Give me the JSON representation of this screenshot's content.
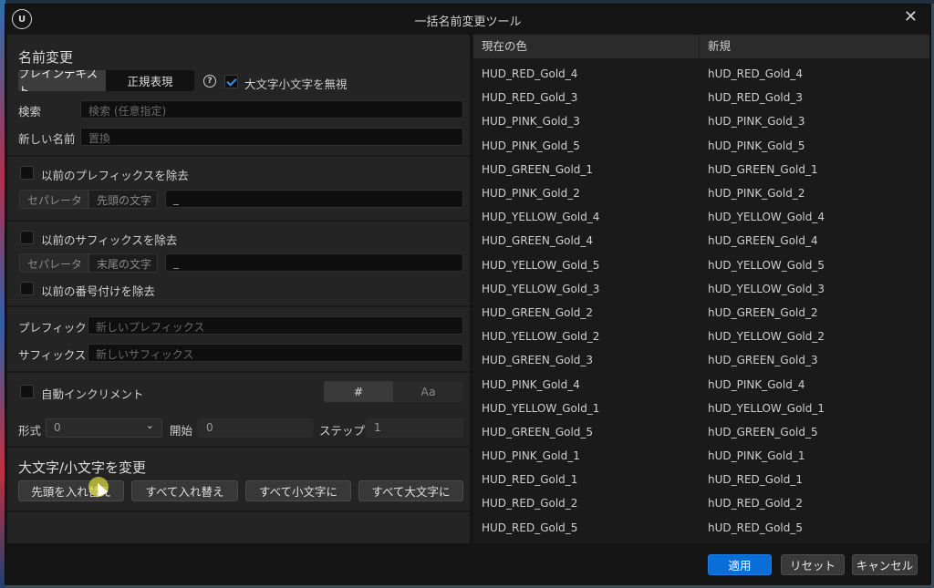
{
  "window": {
    "title": "一括名前変更ツール"
  },
  "rename": {
    "section_title": "名前変更",
    "mode_plain": "プレインテキスト",
    "mode_regex": "正規表現",
    "ignore_case_label": "大文字小文字を無視",
    "search_label": "検索",
    "search_placeholder": "検索 (任意指定)",
    "new_name_label": "新しい名前",
    "new_name_placeholder": "置換"
  },
  "prefix_remove": {
    "label": "以前のプレフィックスを除去",
    "separator_label": "セパレータ",
    "mode_label": "先頭の文字",
    "value": "_"
  },
  "suffix_remove": {
    "label": "以前のサフィックスを除去",
    "separator_label": "セパレータ",
    "mode_label": "末尾の文字",
    "value": "_"
  },
  "numbering_remove": {
    "label": "以前の番号付けを除去"
  },
  "affix": {
    "prefix_label": "プレフィック",
    "prefix_placeholder": "新しいプレフィックス",
    "suffix_label": "サフィックス",
    "suffix_placeholder": "新しいサフィックス"
  },
  "increment": {
    "label": "自動インクリメント",
    "opt_hash": "#",
    "opt_aa": "Aa",
    "format_label": "形式",
    "format_value": "0",
    "start_label": "開始",
    "start_value": "0",
    "step_label": "ステップ",
    "step_value": "1"
  },
  "case": {
    "section_title": "大文字/小文字を変更",
    "btn_first": "先頭を入れ替え",
    "btn_swap_all": "すべて入れ替え",
    "btn_lower": "すべて小文字に",
    "btn_upper": "すべて大文字に"
  },
  "table": {
    "col_current": "現在の色",
    "col_new": "新規",
    "rows": [
      [
        "HUD_RED_Gold_4",
        "hUD_RED_Gold_4"
      ],
      [
        "HUD_RED_Gold_3",
        "hUD_RED_Gold_3"
      ],
      [
        "HUD_PINK_Gold_3",
        "hUD_PINK_Gold_3"
      ],
      [
        "HUD_PINK_Gold_5",
        "hUD_PINK_Gold_5"
      ],
      [
        "HUD_GREEN_Gold_1",
        "hUD_GREEN_Gold_1"
      ],
      [
        "HUD_PINK_Gold_2",
        "hUD_PINK_Gold_2"
      ],
      [
        "HUD_YELLOW_Gold_4",
        "hUD_YELLOW_Gold_4"
      ],
      [
        "HUD_GREEN_Gold_4",
        "hUD_GREEN_Gold_4"
      ],
      [
        "HUD_YELLOW_Gold_5",
        "hUD_YELLOW_Gold_5"
      ],
      [
        "HUD_YELLOW_Gold_3",
        "hUD_YELLOW_Gold_3"
      ],
      [
        "HUD_GREEN_Gold_2",
        "hUD_GREEN_Gold_2"
      ],
      [
        "HUD_YELLOW_Gold_2",
        "hUD_YELLOW_Gold_2"
      ],
      [
        "HUD_GREEN_Gold_3",
        "hUD_GREEN_Gold_3"
      ],
      [
        "HUD_PINK_Gold_4",
        "hUD_PINK_Gold_4"
      ],
      [
        "HUD_YELLOW_Gold_1",
        "hUD_YELLOW_Gold_1"
      ],
      [
        "HUD_GREEN_Gold_5",
        "hUD_GREEN_Gold_5"
      ],
      [
        "HUD_PINK_Gold_1",
        "hUD_PINK_Gold_1"
      ],
      [
        "HUD_RED_Gold_1",
        "hUD_RED_Gold_1"
      ],
      [
        "HUD_RED_Gold_2",
        "hUD_RED_Gold_2"
      ],
      [
        "HUD_RED_Gold_5",
        "hUD_RED_Gold_5"
      ]
    ]
  },
  "footer": {
    "apply": "適用",
    "reset": "リセット",
    "cancel": "キャンセル"
  },
  "colors": {
    "accent": "#0a6ed8",
    "check": "#3b8fe8"
  }
}
